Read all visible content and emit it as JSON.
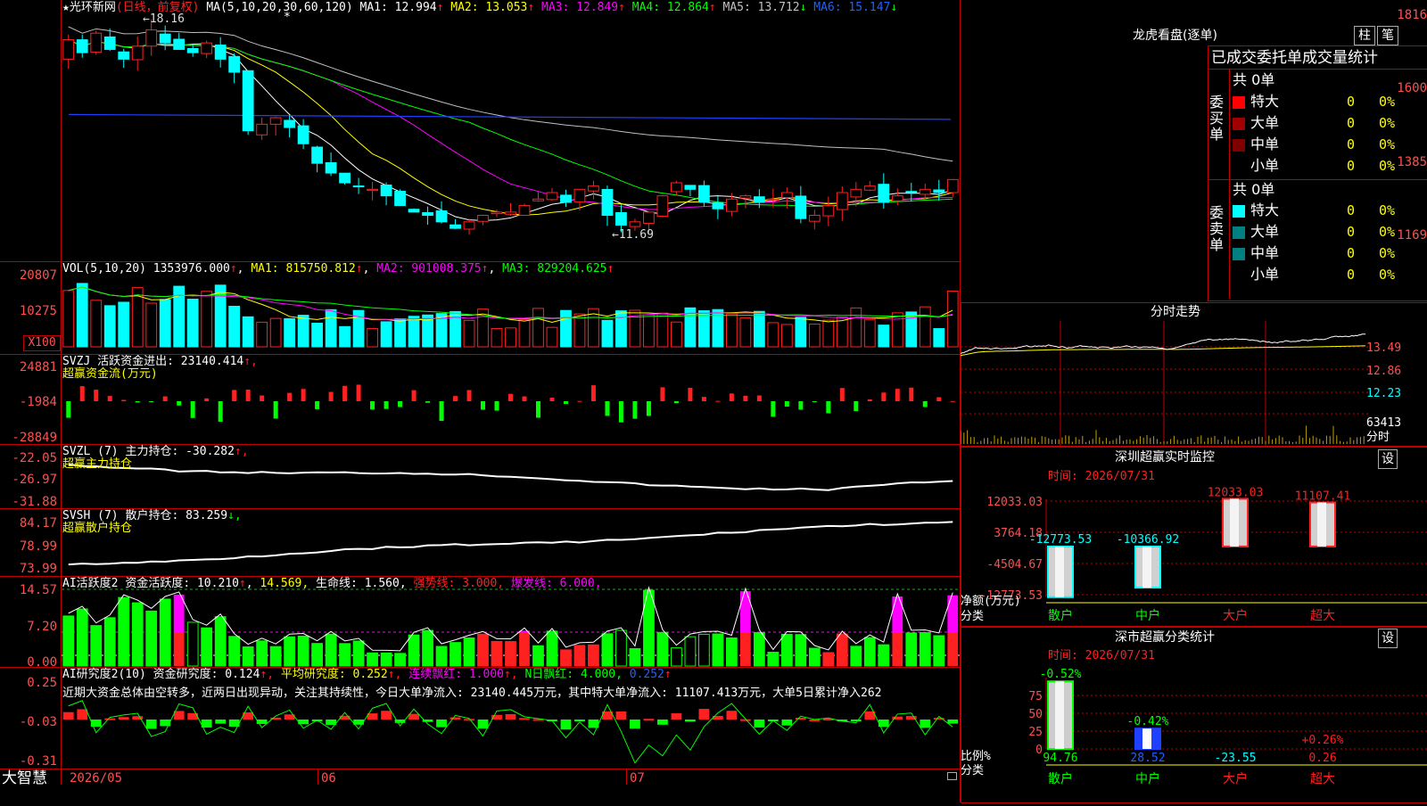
{
  "app": {
    "brand": "大智慧"
  },
  "stock": {
    "name": "★光环新网",
    "period": "(日线，前复权)"
  },
  "main_panel": {
    "ma_title": "MA(5,10,20,30,60,120)",
    "ma": [
      {
        "label": "MA1: 12.994",
        "arrow": "↑",
        "color": "#ffffff"
      },
      {
        "label": "MA2: 13.053",
        "arrow": "↑",
        "color": "#ffff00"
      },
      {
        "label": "MA3: 12.849",
        "arrow": "↑",
        "color": "#ff00ff"
      },
      {
        "label": "MA4: 12.864",
        "arrow": "↑",
        "color": "#00ff00"
      },
      {
        "label": "MA5: 13.712",
        "arrow": "↓",
        "color": "#c0c0c0"
      },
      {
        "label": "MA6: 15.147",
        "arrow": "↓",
        "color": "#2060ff"
      }
    ],
    "y_ticks": [
      "1816",
      "1600",
      "1385",
      "1169"
    ],
    "high_note": "←18.16",
    "low_note": "←11.69",
    "star": "*"
  },
  "vol_panel": {
    "title": "VOL(5,10,20)",
    "value": "1353976.000",
    "ma1": "MA1: 815750.812",
    "ma2": "MA2: 901008.375",
    "ma3": "MA3: 829204.625",
    "arrow": "↑",
    "y_ticks": [
      "20807",
      "10275"
    ],
    "unit": "X100"
  },
  "svzj_panel": {
    "title": "SVZJ",
    "label": "活跃资金进出: 23140.414",
    "sub": "超赢资金流(万元)",
    "arrow": "↑,",
    "y_ticks": [
      "24881",
      "-1984",
      "-28849"
    ]
  },
  "svzl_panel": {
    "title": "SVZL (7)",
    "label": "主力持仓: -30.282",
    "sub": "超赢主力持仓",
    "arrow": "↑,",
    "y_ticks": [
      "-22.05",
      "-26.97",
      "-31.88"
    ]
  },
  "svsh_panel": {
    "title": "SVSH (7)",
    "label": "散户持仓: 83.259",
    "sub": "超赢散户持仓",
    "arrow": "↓,",
    "y_ticks": [
      "84.17",
      "78.99",
      "73.99"
    ]
  },
  "ai_active_panel": {
    "title": "AI活跃度2",
    "label": "资金活跃度: 10.210",
    "v2": "14.569,",
    "v3": "生命线: 1.560,",
    "v4": "强势线: 3.000,",
    "v5": "爆发线: 6.000,",
    "y_ticks": [
      "14.57",
      "7.20",
      "0.00"
    ]
  },
  "ai_research_panel": {
    "title": "AI研究度2(10)",
    "label": "资金研究度: 0.124",
    "avg": "平均研究度: 0.252",
    "cont": "连续飘红: 1.000",
    "nday": "N日飘红: 4.000,",
    "nday2": "0.252",
    "comment": "近期大资金总体由空转多，近两日出现异动，关注其持续性，今日大单净流入: 23140.445万元，其中特大单净流入: 11107.413万元，大单5日累计净入262",
    "y_ticks": [
      "0.25",
      "-0.03",
      "-0.31"
    ]
  },
  "x_axis": [
    "2026/05",
    "06",
    "07"
  ],
  "dragon": {
    "title": "龙虎看盘(逐单)",
    "btn1": "柱",
    "btn2": "笔",
    "header": "已成交委托单成交量统计",
    "buy_side": "委买单",
    "sell_side": "委卖单",
    "buy_total": "共 0单",
    "sell_total": "共 0单",
    "buy_rows": [
      {
        "name": "特大",
        "count": "0",
        "pct": "0%",
        "color": "#ff0000"
      },
      {
        "name": "大单",
        "count": "0",
        "pct": "0%",
        "color": "#a00000"
      },
      {
        "name": "中单",
        "count": "0",
        "pct": "0%",
        "color": "#800000"
      },
      {
        "name": "小单",
        "count": "0",
        "pct": "0%",
        "color": ""
      }
    ],
    "sell_rows": [
      {
        "name": "特大",
        "count": "0",
        "pct": "0%",
        "color": "#00ffff"
      },
      {
        "name": "大单",
        "count": "0",
        "pct": "0%",
        "color": "#008080"
      },
      {
        "name": "中单",
        "count": "0",
        "pct": "0%",
        "color": "#008080"
      },
      {
        "name": "小单",
        "count": "0",
        "pct": "0%",
        "color": ""
      }
    ]
  },
  "intraday": {
    "title": "分时走势",
    "y_ticks": [
      "13.49",
      "12.86",
      "12.23"
    ],
    "vol_label": "63413",
    "time_label": "分时"
  },
  "sz_monitor": {
    "title": "深圳超赢实时监控",
    "settings": "设",
    "time": "时间: 2026/07/31",
    "y_ticks": [
      "12033.03",
      "3764.18",
      "-4504.67",
      "-12773.53"
    ],
    "ylabel": "净额(万元)",
    "xlabel": "分类",
    "categories": [
      "散户",
      "中户",
      "大户",
      "超大"
    ],
    "values": [
      -12773.53,
      -10366.92,
      12033.03,
      11107.41
    ],
    "value_labels": [
      "-12773.53",
      "-10366.92",
      "12033.03",
      "11107.41"
    ]
  },
  "sz_class": {
    "title": "深市超赢分类统计",
    "settings": "设",
    "time": "时间: 2026/07/31",
    "y_ticks": [
      "75",
      "50",
      "25",
      "0"
    ],
    "ylabel": "比例%",
    "xlabel": "分类",
    "categories": [
      "散户",
      "中户",
      "大户",
      "超大"
    ],
    "top_labels": [
      "-0.52%",
      "-0.42%",
      "",
      "+0.26%"
    ],
    "values": [
      94.76,
      28.52,
      -23.55,
      0.26
    ],
    "value_labels": [
      "94.76",
      "28.52",
      "-23.55",
      "0.26"
    ]
  },
  "colors": {
    "up": "#ff2020",
    "down": "#00ffff",
    "border": "#c00000",
    "green": "#00ff00",
    "magenta": "#ff00ff"
  }
}
